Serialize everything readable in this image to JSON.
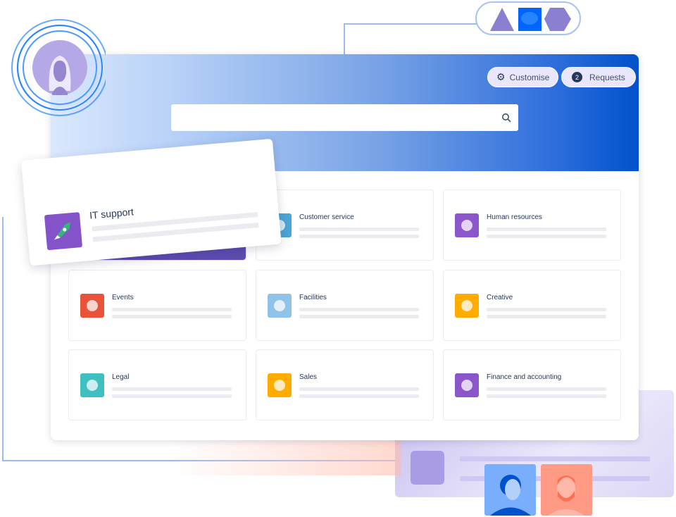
{
  "header": {
    "customise_label": "Customise",
    "requests_count": "2",
    "requests_label": "Requests",
    "search_placeholder": ""
  },
  "floating_card": {
    "title": "IT support",
    "icon": "rocket-icon"
  },
  "cards": [
    {
      "title": "",
      "icon": "",
      "color": "#5e4db2"
    },
    {
      "title": "Customer service",
      "icon": "koala-icon",
      "color": "#4ba5d6"
    },
    {
      "title": "Human resources",
      "icon": "parrot-icon",
      "color": "#8a56c9"
    },
    {
      "title": "Events",
      "icon": "disc-icon",
      "color": "#e8533a"
    },
    {
      "title": "Facilities",
      "icon": "mountain-icon",
      "color": "#8fc3e8"
    },
    {
      "title": "Creative",
      "icon": "easel-icon",
      "color": "#ffab00"
    },
    {
      "title": "Legal",
      "icon": "wallet-icon",
      "color": "#3fbfbf"
    },
    {
      "title": "Sales",
      "icon": "wallet-icon",
      "color": "#ffab00"
    },
    {
      "title": "Finance and accounting",
      "icon": "potion-icon",
      "color": "#8a56c9"
    }
  ],
  "colors": {
    "brand": "#0052cc",
    "accent_purple": "#8777d9"
  }
}
